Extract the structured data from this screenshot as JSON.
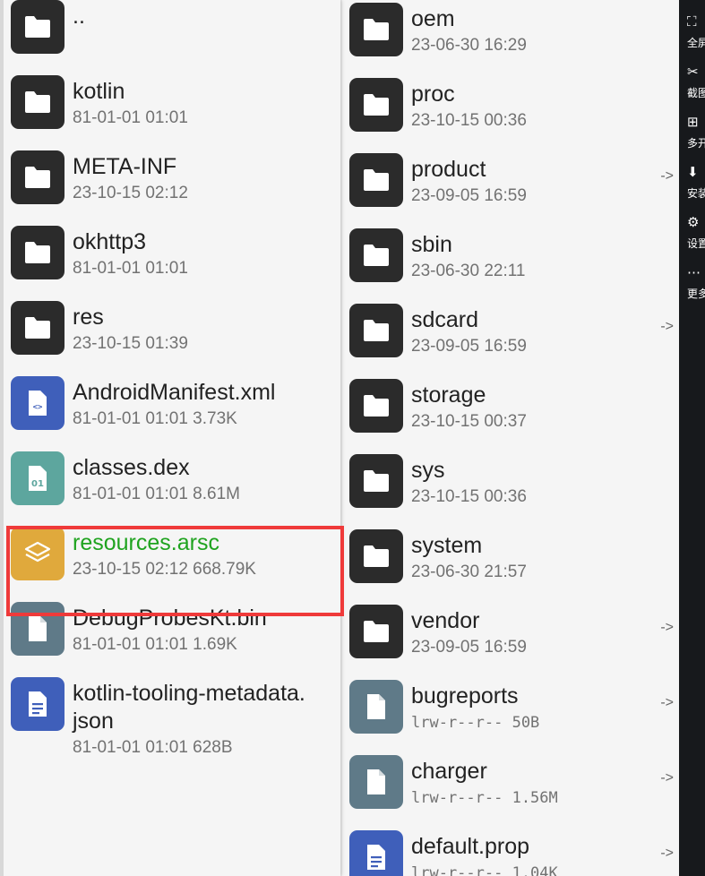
{
  "left_panel": {
    "items": [
      {
        "name": "..",
        "meta": "",
        "icon": "folder-icon",
        "color": "#2b2b2b"
      },
      {
        "name": "kotlin",
        "meta": "81-01-01 01:01",
        "icon": "folder-icon",
        "color": "#2b2b2b"
      },
      {
        "name": "META-INF",
        "meta": "23-10-15 02:12",
        "icon": "folder-icon",
        "color": "#2b2b2b"
      },
      {
        "name": "okhttp3",
        "meta": "81-01-01 01:01",
        "icon": "folder-icon",
        "color": "#2b2b2b"
      },
      {
        "name": "res",
        "meta": "23-10-15 01:39",
        "icon": "folder-icon",
        "color": "#2b2b2b"
      },
      {
        "name": "AndroidManifest.xml",
        "meta": "81-01-01 01:01  3.73K",
        "icon": "xml-file-icon",
        "color": "#3f5fba"
      },
      {
        "name": "classes.dex",
        "meta": "81-01-01 01:01  8.61M",
        "icon": "dex-file-icon",
        "color": "#5da69e"
      },
      {
        "name": "resources.arsc",
        "meta": "23-10-15 02:12  668.79K",
        "icon": "layers-file-icon",
        "color": "#e0a93c"
      },
      {
        "name": "DebugProbesKt.bin",
        "meta": "81-01-01 01:01  1.69K",
        "icon": "file-icon",
        "color": "#5f7a88"
      },
      {
        "name": "kotlin-tooling-metadata.",
        "name2": "json",
        "meta": "81-01-01 01:01  628B",
        "icon": "text-file-icon",
        "color": "#3f5fba"
      }
    ]
  },
  "right_panel": {
    "items": [
      {
        "name": "oem",
        "meta": "23-06-30 16:29",
        "icon": "folder-icon",
        "color": "#2b2b2b",
        "link": ""
      },
      {
        "name": "proc",
        "meta": "23-10-15 00:36",
        "icon": "folder-icon",
        "color": "#2b2b2b",
        "link": ""
      },
      {
        "name": "product",
        "meta": "23-09-05 16:59",
        "icon": "folder-icon",
        "color": "#2b2b2b",
        "link": "->"
      },
      {
        "name": "sbin",
        "meta": "23-06-30 22:11",
        "icon": "folder-icon",
        "color": "#2b2b2b",
        "link": ""
      },
      {
        "name": "sdcard",
        "meta": "23-09-05 16:59",
        "icon": "folder-icon",
        "color": "#2b2b2b",
        "link": "->"
      },
      {
        "name": "storage",
        "meta": "23-10-15 00:37",
        "icon": "folder-icon",
        "color": "#2b2b2b",
        "link": ""
      },
      {
        "name": "sys",
        "meta": "23-10-15 00:36",
        "icon": "folder-icon",
        "color": "#2b2b2b",
        "link": ""
      },
      {
        "name": "system",
        "meta": "23-06-30 21:57",
        "icon": "folder-icon",
        "color": "#2b2b2b",
        "link": ""
      },
      {
        "name": "vendor",
        "meta": "23-09-05 16:59",
        "icon": "folder-icon",
        "color": "#2b2b2b",
        "link": "->"
      },
      {
        "name": "bugreports",
        "meta": "lrw-r--r--  50B",
        "icon": "file-icon",
        "color": "#5f7a88",
        "link": "->"
      },
      {
        "name": "charger",
        "meta": "lrw-r--r--  1.56M",
        "icon": "file-icon",
        "color": "#5f7a88",
        "link": "->"
      },
      {
        "name": "default.prop",
        "meta": "lrw-r--r--  1.04K",
        "icon": "text-file-icon",
        "color": "#3f5fba",
        "link": "->"
      }
    ]
  },
  "toolbar": {
    "items": [
      {
        "label": "全屏",
        "icon": "fullscreen-icon"
      },
      {
        "label": "截图",
        "icon": "scissors-icon"
      },
      {
        "label": "多开",
        "icon": "multi-open-icon"
      },
      {
        "label": "安装",
        "icon": "apk-install-icon"
      },
      {
        "label": "设置",
        "icon": "settings-icon"
      },
      {
        "label": "更多",
        "icon": "more-icon"
      }
    ]
  },
  "colors": {
    "highlight_border": "#ef3a3a",
    "selected_text": "#1fa31f"
  }
}
